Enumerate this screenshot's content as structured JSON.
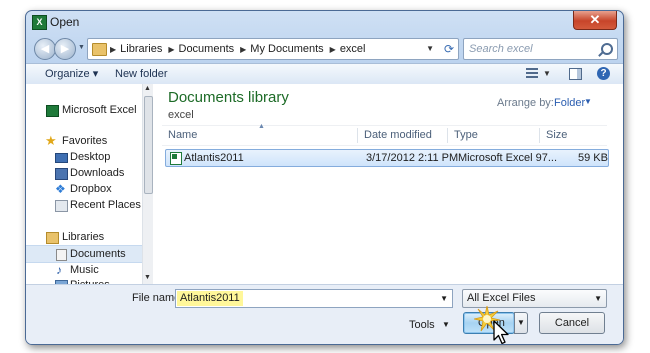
{
  "window": {
    "title": "Open",
    "close_symbol": "✕"
  },
  "navigation": {
    "breadcrumbs": [
      "Libraries",
      "Documents",
      "My Documents",
      "excel"
    ],
    "search_placeholder": "Search excel"
  },
  "toolbar": {
    "organize_label": "Organize ▾",
    "new_folder_label": "New folder",
    "help_symbol": "?"
  },
  "sidebar": {
    "items": [
      {
        "label": "Microsoft Excel",
        "icon": "excel-icon"
      },
      {
        "label": "Favorites",
        "icon": "star-icon"
      },
      {
        "label": "Desktop",
        "icon": "desktop-icon"
      },
      {
        "label": "Downloads",
        "icon": "downloads-icon"
      },
      {
        "label": "Dropbox",
        "icon": "dropbox-icon"
      },
      {
        "label": "Recent Places",
        "icon": "recent-places-icon"
      },
      {
        "label": "Libraries",
        "icon": "libraries-icon"
      },
      {
        "label": "Documents",
        "icon": "documents-icon",
        "selected": true
      },
      {
        "label": "Music",
        "icon": "music-icon"
      },
      {
        "label": "Pictures",
        "icon": "pictures-icon"
      }
    ]
  },
  "library": {
    "title": "Documents library",
    "subtitle": "excel",
    "arrange_label": "Arrange by:",
    "arrange_value": "Folder"
  },
  "file_list": {
    "columns": [
      "Name",
      "Date modified",
      "Type",
      "Size"
    ],
    "rows": [
      {
        "name": "Atlantis2011",
        "date": "3/17/2012 2:11 PM",
        "type": "Microsoft Excel 97...",
        "size": "59 KB"
      }
    ]
  },
  "bottom": {
    "file_name_label": "File name:",
    "file_name_value": "Atlantis2011",
    "file_type_value": "All Excel Files",
    "tools_label": "Tools",
    "open_label": "Open",
    "cancel_label": "Cancel"
  },
  "colors": {
    "accent": "#1d6b27",
    "selection": "#cfe4fb",
    "highlight": "#fff79a"
  }
}
